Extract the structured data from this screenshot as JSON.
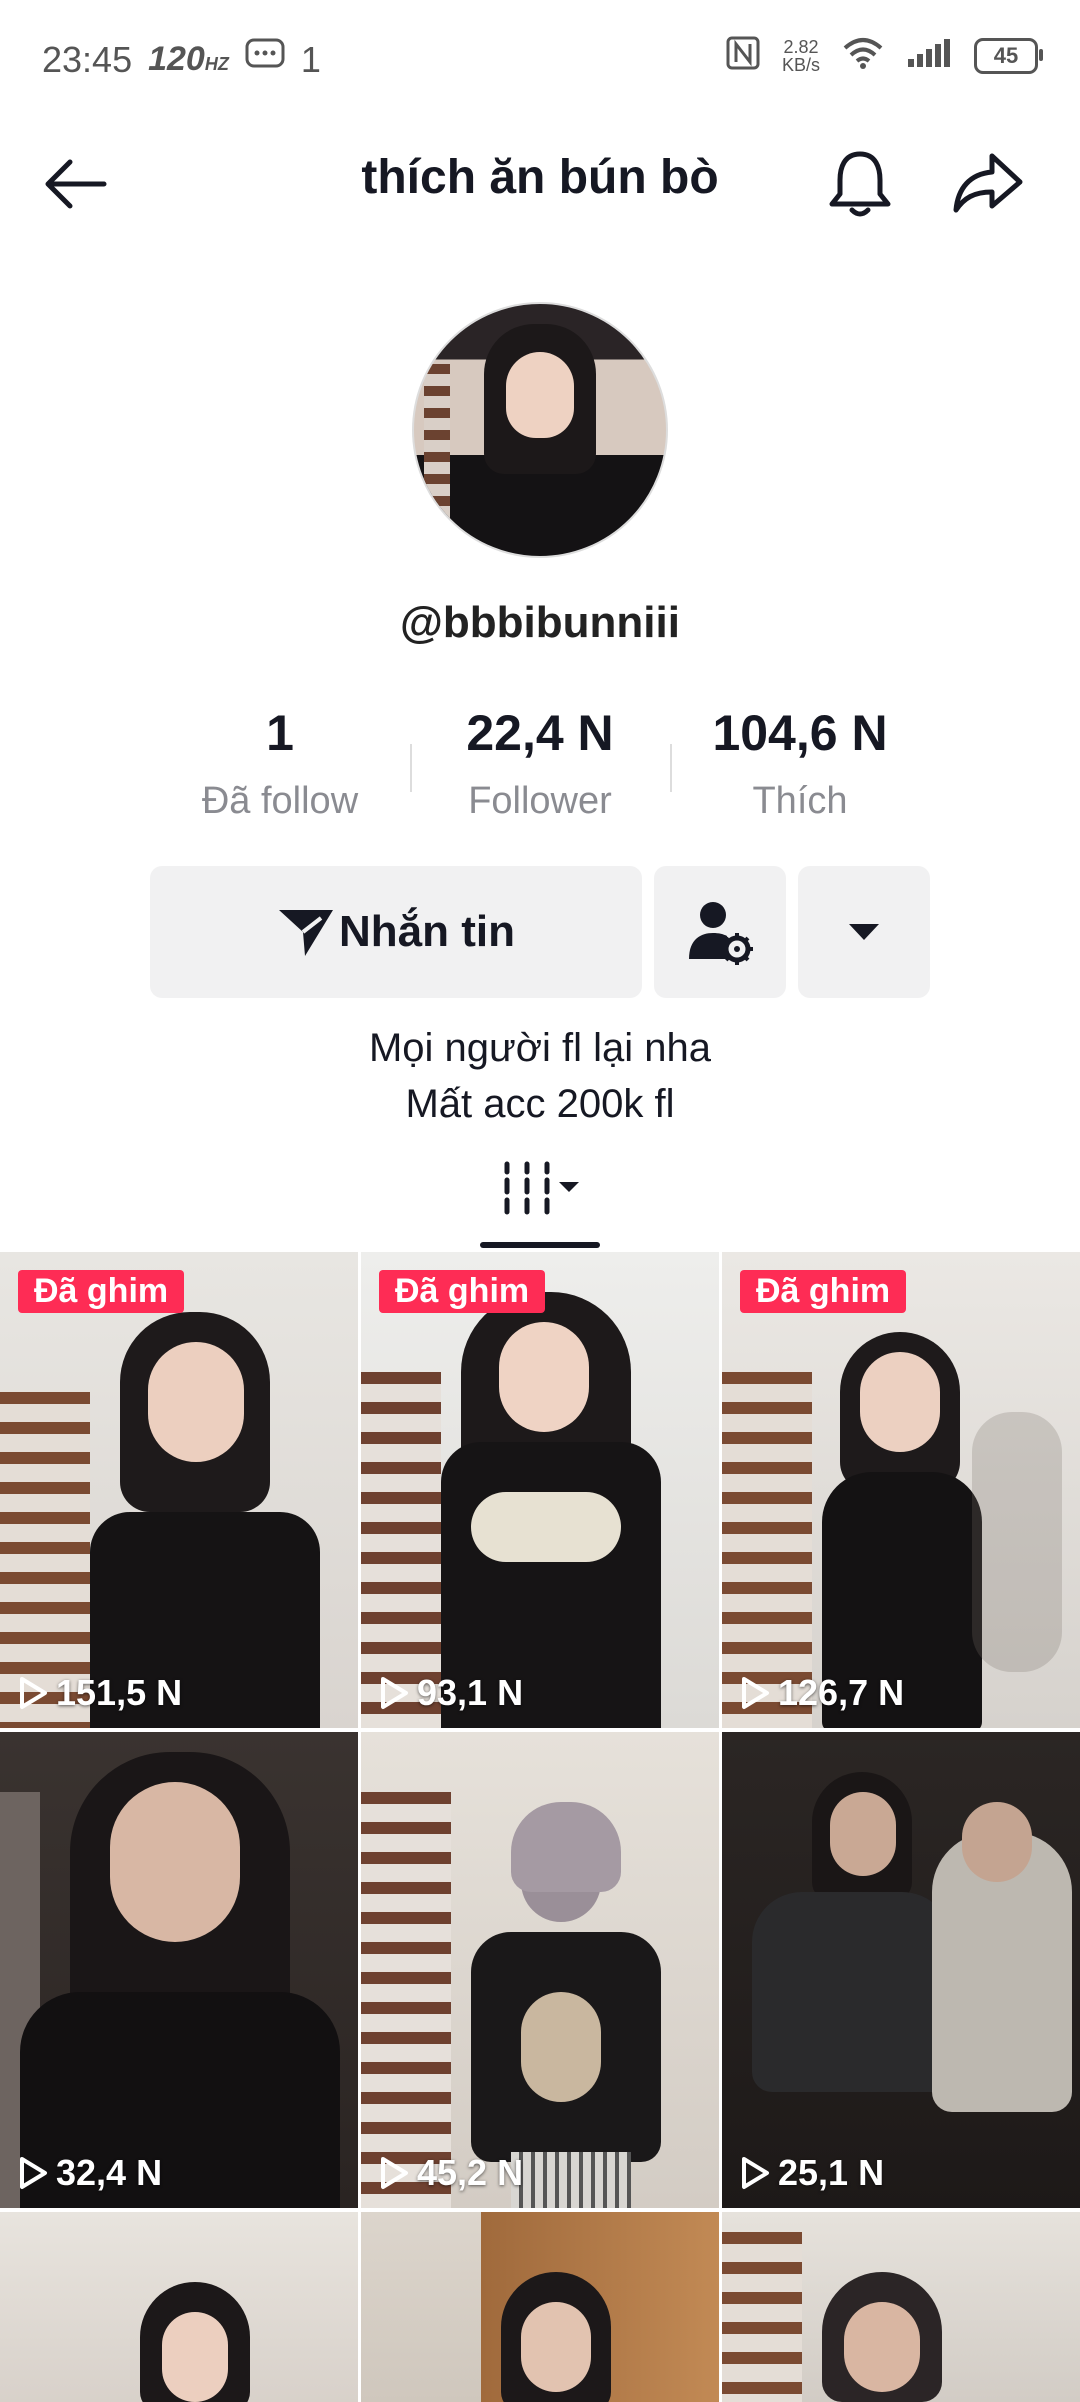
{
  "status_bar": {
    "time": "23:45",
    "refresh_rate": "120",
    "refresh_unit": "HZ",
    "notification_count": "1",
    "speed_value": "2.82",
    "speed_unit": "KB/s",
    "battery": "45"
  },
  "header": {
    "title": "thích ăn bún bò"
  },
  "profile": {
    "username": "@bbbibunniii",
    "stats": [
      {
        "value": "1",
        "label": "Đã follow"
      },
      {
        "value": "22,4 N",
        "label": "Follower"
      },
      {
        "value": "104,6 N",
        "label": "Thích"
      }
    ],
    "message_button": "Nhắn tin",
    "bio_line1": "Mọi người fl lại nha",
    "bio_line2": "Mất acc 200k fl"
  },
  "videos": [
    {
      "pinned_label": "Đã ghim",
      "views": "151,5 N"
    },
    {
      "pinned_label": "Đã ghim",
      "views": "93,1 N"
    },
    {
      "pinned_label": "Đã ghim",
      "views": "126,7 N"
    },
    {
      "views": "32,4 N"
    },
    {
      "views": "45,2 N"
    },
    {
      "views": "25,1 N"
    },
    {},
    {},
    {}
  ],
  "colors": {
    "accent": "#fe2c55",
    "button_bg": "#f1f1f2",
    "secondary_text": "#8a8b91"
  }
}
